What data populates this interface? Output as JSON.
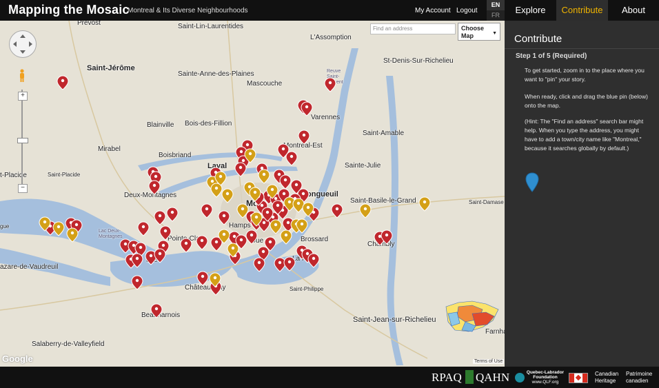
{
  "header": {
    "brand": "Mapping the Mosaic",
    "tagline": "Montreal & Its Diverse Neighbourhoods",
    "my_account": "My Account",
    "logout": "Logout",
    "lang_en": "EN",
    "lang_fr": "FR"
  },
  "tabs": {
    "explore": "Explore",
    "contribute": "Contribute",
    "about": "About"
  },
  "sidebar": {
    "title": "Contribute",
    "step": "Step 1 of 5 (Required)",
    "p1": "To get started, zoom in to the place where you want to \"pin\" your story.",
    "p2": "When ready, click and drag the blue pin (below) onto the map.",
    "p3": "(Hint: The \"Find an address\" search bar might help. When you type the address, you might have to add a town/city name like \"Montreal,\" because it searches globally by default.)"
  },
  "map": {
    "search_placeholder": "Find an address",
    "choose_map": "Choose Map",
    "google": "Google",
    "terms": "Terms of Use",
    "zoom_in": "+",
    "zoom_out": "−",
    "places": {
      "prevost": "Prévost",
      "saint_lin": "Saint-Lin-Laurentides",
      "lassomption": "L'Assomption",
      "saint_jerome": "Saint-Jérôme",
      "ste_anne_plaines": "Sainte-Anne-des-Plaines",
      "mascouche": "Mascouche",
      "st_denis": "St-Denis-Sur-Richelieu",
      "blainville": "Blainville",
      "boisdesfillion": "Bois-des-Fillion",
      "varennes": "Varennes",
      "mirabel": "Mirabel",
      "saint_amable": "Saint-Amable",
      "montreal_est": "Montreal-Est",
      "boisbriand": "Boisbriand",
      "laval": "Laval",
      "sainte_julie": "Sainte-Julie",
      "placide": "t-Placide",
      "saint_placide2": "Saint-Placide",
      "longueuil": "ongueuil",
      "deux_montagnes": "Deux-Montagnes",
      "mo": "Mo",
      "st_basile": "Saint-Basile-le-Grand",
      "st_damase": "Saint-Damase",
      "hamps": "Hamps",
      "pointe_claire": "Pointe-Cla",
      "ouest": "-Oue",
      "brossard": "Brossard",
      "chambly": "Chambly",
      "gue": "gue",
      "vaudreuil": "azare-de-Vaudreuil",
      "dorval": "drie",
      "la_prai": "La Pra",
      "saint_philippe": "Saint-Philippe",
      "chateauguay": "Châteauguay",
      "beauharnois": "Beauharnois",
      "st_jean": "Saint-Jean-sur-Richelieu",
      "farnha": "Farnha",
      "salaberry": "Salaberry-de-Valleyfield",
      "lac_deux": "Lac Deux-Montagnes",
      "reuve": "Reuve Saint-Laurent"
    }
  },
  "footer": {
    "rpaq": "RPAQ",
    "qahn": "QAHN",
    "qlf": "Quebec-Labrador Foundation",
    "qlf_url": "www.QLF.org",
    "ch1": "Canadian",
    "ch2": "Heritage",
    "pc1": "Patrimoine",
    "pc2": "canadien"
  },
  "colors": {
    "accent": "#f0b400",
    "pin_red": "#c0272d",
    "pin_gold": "#d4a017",
    "pin_blue": "#2f8fd0",
    "water": "#a5bfdd",
    "land": "#e6e2d6"
  }
}
